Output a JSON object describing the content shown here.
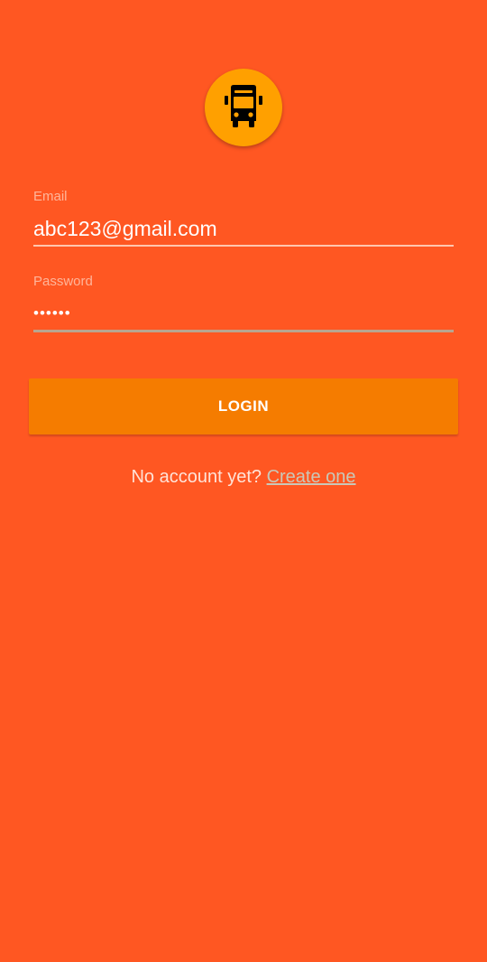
{
  "logo": {
    "icon": "bus-icon",
    "background": "#FFA000"
  },
  "email": {
    "label": "Email",
    "value": "abc123@gmail.com"
  },
  "password": {
    "label": "Password",
    "value": "••••••"
  },
  "login_button": {
    "label": "LOGIN",
    "color": "#F57C00"
  },
  "signup": {
    "prompt": "No account yet? ",
    "link": "Create one"
  },
  "colors": {
    "background": "#FF5722"
  }
}
